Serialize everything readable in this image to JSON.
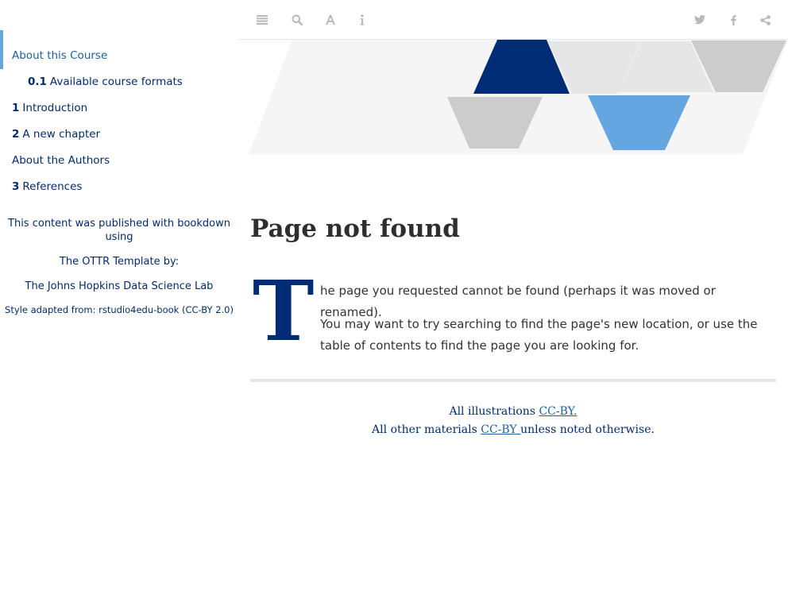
{
  "sidebar": {
    "toc": [
      {
        "number": "",
        "label": "About this Course",
        "active": true
      },
      {
        "number": "0.1",
        "label": "Available course formats",
        "active": false
      },
      {
        "number": "1",
        "label": "Introduction",
        "active": false
      },
      {
        "number": "2",
        "label": "A new chapter",
        "active": false
      },
      {
        "number": "",
        "label": "About the Authors",
        "active": false
      },
      {
        "number": "3",
        "label": "References",
        "active": false
      }
    ],
    "credits": {
      "published": "This content was published with bookdown using",
      "template": "The OTTR Template by:",
      "lab": "The Johns Hopkins Data Science Lab",
      "style": "Style adapted from: rstudio4edu-book (CC-BY 2.0)"
    }
  },
  "toolbar": {
    "left_icons": [
      "menu-icon",
      "search-icon",
      "font-icon",
      "info-icon"
    ],
    "right_icons": [
      "twitter-icon",
      "facebook-icon",
      "share-icon"
    ],
    "icon_color": "#b8b8b8"
  },
  "main": {
    "title": "Page not found",
    "dropcap": "T",
    "para1": "he page you requested cannot be found (perhaps it was moved or renamed).",
    "para2": "You may want to try searching to find the page's new location, or use the table of contents to find the page you are looking for."
  },
  "footer": {
    "line1_prefix": "All illustrations ",
    "line1_link": "CC-BY.",
    "line2_prefix": "All other materials ",
    "line2_link": "CC-BY ",
    "line2_suffix": "unless noted otherwise."
  },
  "colors": {
    "brand_dark_blue": "#002b75",
    "brand_light_blue": "#66a6e0",
    "link_blue": "#1a5fa8",
    "banner_gray": "#cccccc",
    "banner_light_gray": "#e6e6e6"
  }
}
